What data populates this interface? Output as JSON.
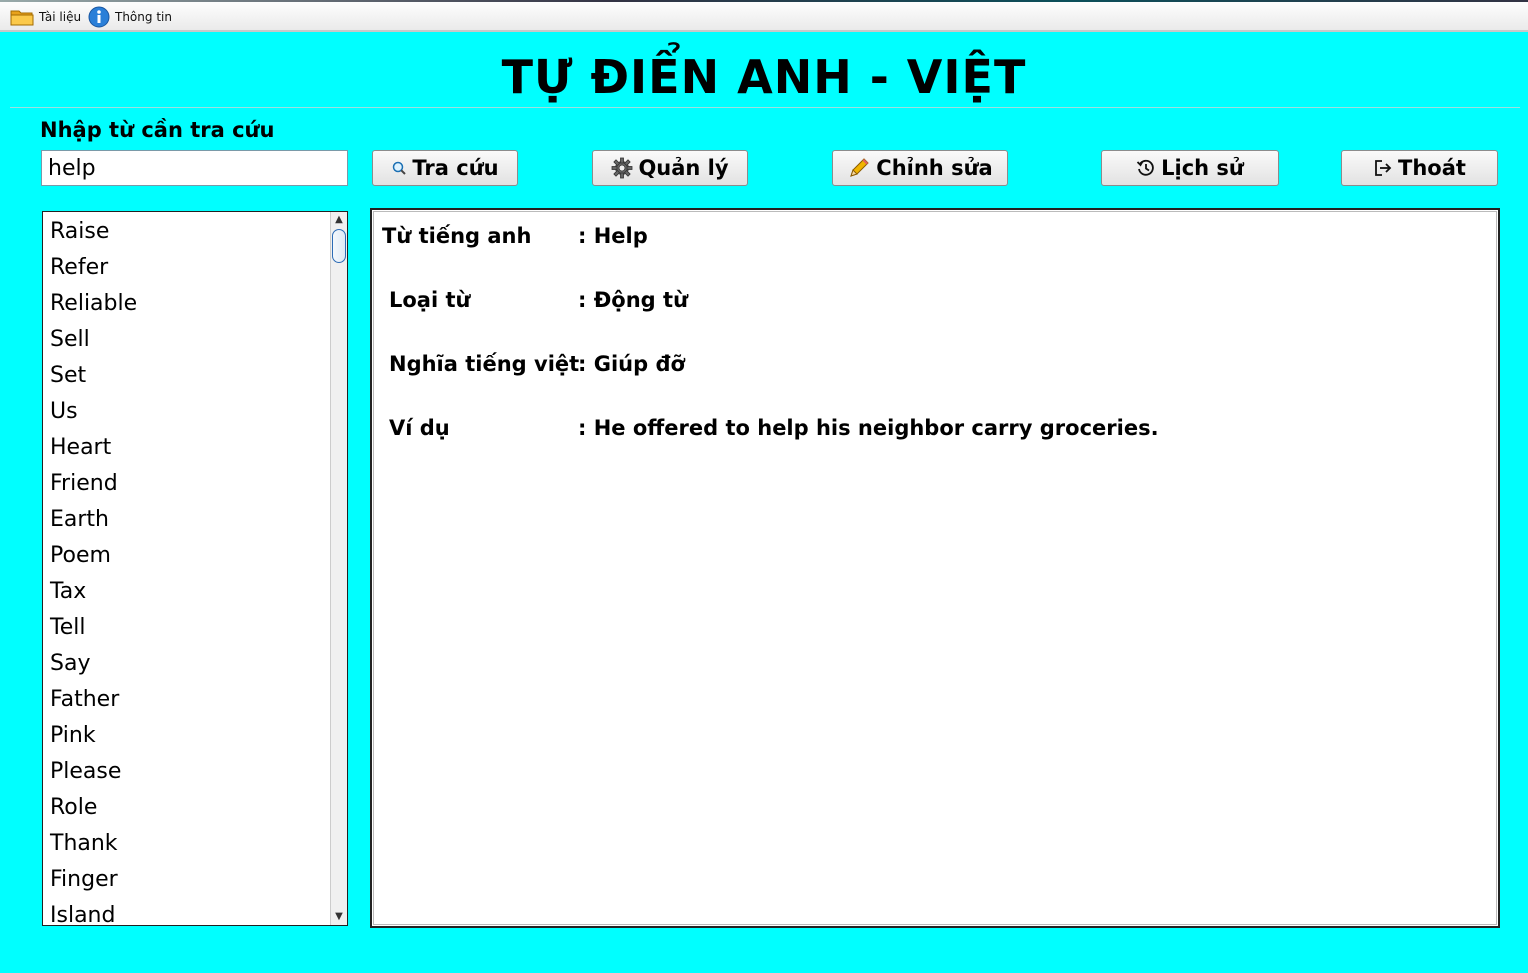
{
  "menu": {
    "documents_label": "Tài liệu",
    "documents_icon": "folder-icon",
    "info_label": "Thông tin",
    "info_icon": "info-icon"
  },
  "title": "TỰ ĐIỂN ANH - VIỆT",
  "search": {
    "label": "Nhập từ cần tra cứu",
    "value": "help"
  },
  "buttons": {
    "search": "Tra cứu",
    "manage": "Quản lý",
    "edit": "Chỉnh sửa",
    "history": "Lịch sử",
    "exit": "Thoát"
  },
  "word_list": [
    "Raise",
    "Refer",
    "Reliable",
    "Sell",
    "Set",
    "Us",
    "Heart",
    "Friend",
    "Earth",
    "Poem",
    "Tax",
    "Tell",
    "Say",
    "Father",
    "Pink",
    "Please",
    "Role",
    "Thank",
    "Finger",
    "Island"
  ],
  "detail": {
    "english_label": "Từ tiếng anh",
    "english_value": ": Help",
    "type_label": "Loại từ",
    "type_value": ": Động từ",
    "meaning_label": "Nghĩa tiếng việt",
    "meaning_value": ": Giúp đỡ",
    "example_label": "Ví dụ",
    "example_value": ": He offered to help his neighbor carry groceries."
  },
  "colors": {
    "background": "#00ffff"
  }
}
